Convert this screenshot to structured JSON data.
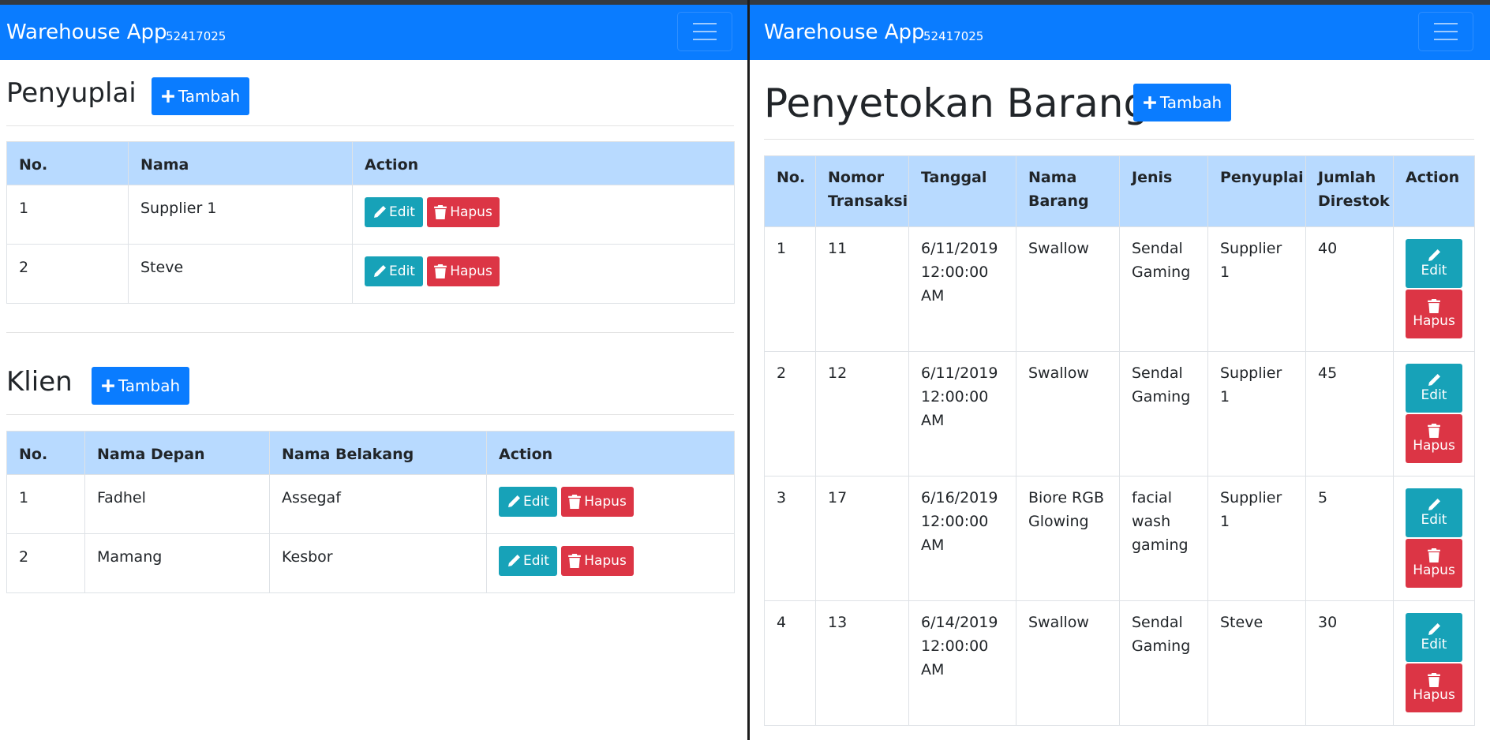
{
  "left_pane": {
    "navbar": {
      "brand": "Warehouse App",
      "sub": "52417025"
    },
    "supplier": {
      "title": "Penyuplai",
      "add_label": "Tambah",
      "headers": [
        "No.",
        "Nama",
        "Action"
      ],
      "rows": [
        {
          "no": "1",
          "name": "Supplier 1"
        },
        {
          "no": "2",
          "name": "Steve"
        }
      ]
    },
    "client": {
      "title": "Klien",
      "add_label": "Tambah",
      "headers": [
        "No.",
        "Nama Depan",
        "Nama Belakang",
        "Action"
      ],
      "rows": [
        {
          "no": "1",
          "first": "Fadhel",
          "last": "Assegaf"
        },
        {
          "no": "2",
          "first": "Mamang",
          "last": "Kesbor"
        }
      ]
    },
    "edit_label": "Edit",
    "delete_label": "Hapus"
  },
  "right_pane": {
    "navbar": {
      "brand": "Warehouse App",
      "sub": "52417025"
    },
    "title": "Penyetokan Barang",
    "add_label": "Tambah",
    "headers": [
      "No.",
      "Nomor Transaksi",
      "Tanggal",
      "Nama Barang",
      "Jenis",
      "Penyuplai",
      "Jumlah Direstok",
      "Action"
    ],
    "rows": [
      {
        "no": "1",
        "trx": "11",
        "date": "6/11/2019 12:00:00 AM",
        "item": "Swallow",
        "type": "Sendal Gaming",
        "supplier": "Supplier 1",
        "qty": "40"
      },
      {
        "no": "2",
        "trx": "12",
        "date": "6/11/2019 12:00:00 AM",
        "item": "Swallow",
        "type": "Sendal Gaming",
        "supplier": "Supplier 1",
        "qty": "45"
      },
      {
        "no": "3",
        "trx": "17",
        "date": "6/16/2019 12:00:00 AM",
        "item": "Biore RGB Glowing",
        "type": "facial wash gaming",
        "supplier": "Supplier 1",
        "qty": "5"
      },
      {
        "no": "4",
        "trx": "13",
        "date": "6/14/2019 12:00:00 AM",
        "item": "Swallow",
        "type": "Sendal Gaming",
        "supplier": "Steve",
        "qty": "30"
      }
    ],
    "edit_label": "Edit",
    "delete_label": "Hapus"
  },
  "icons": {
    "menu": "hamburger-icon",
    "add": "plus-icon",
    "edit": "pencil-icon",
    "delete": "trash-icon"
  },
  "colors": {
    "primary": "#0a7cff",
    "info": "#17a2b8",
    "danger": "#dc3545",
    "table_header": "#b8daff"
  }
}
